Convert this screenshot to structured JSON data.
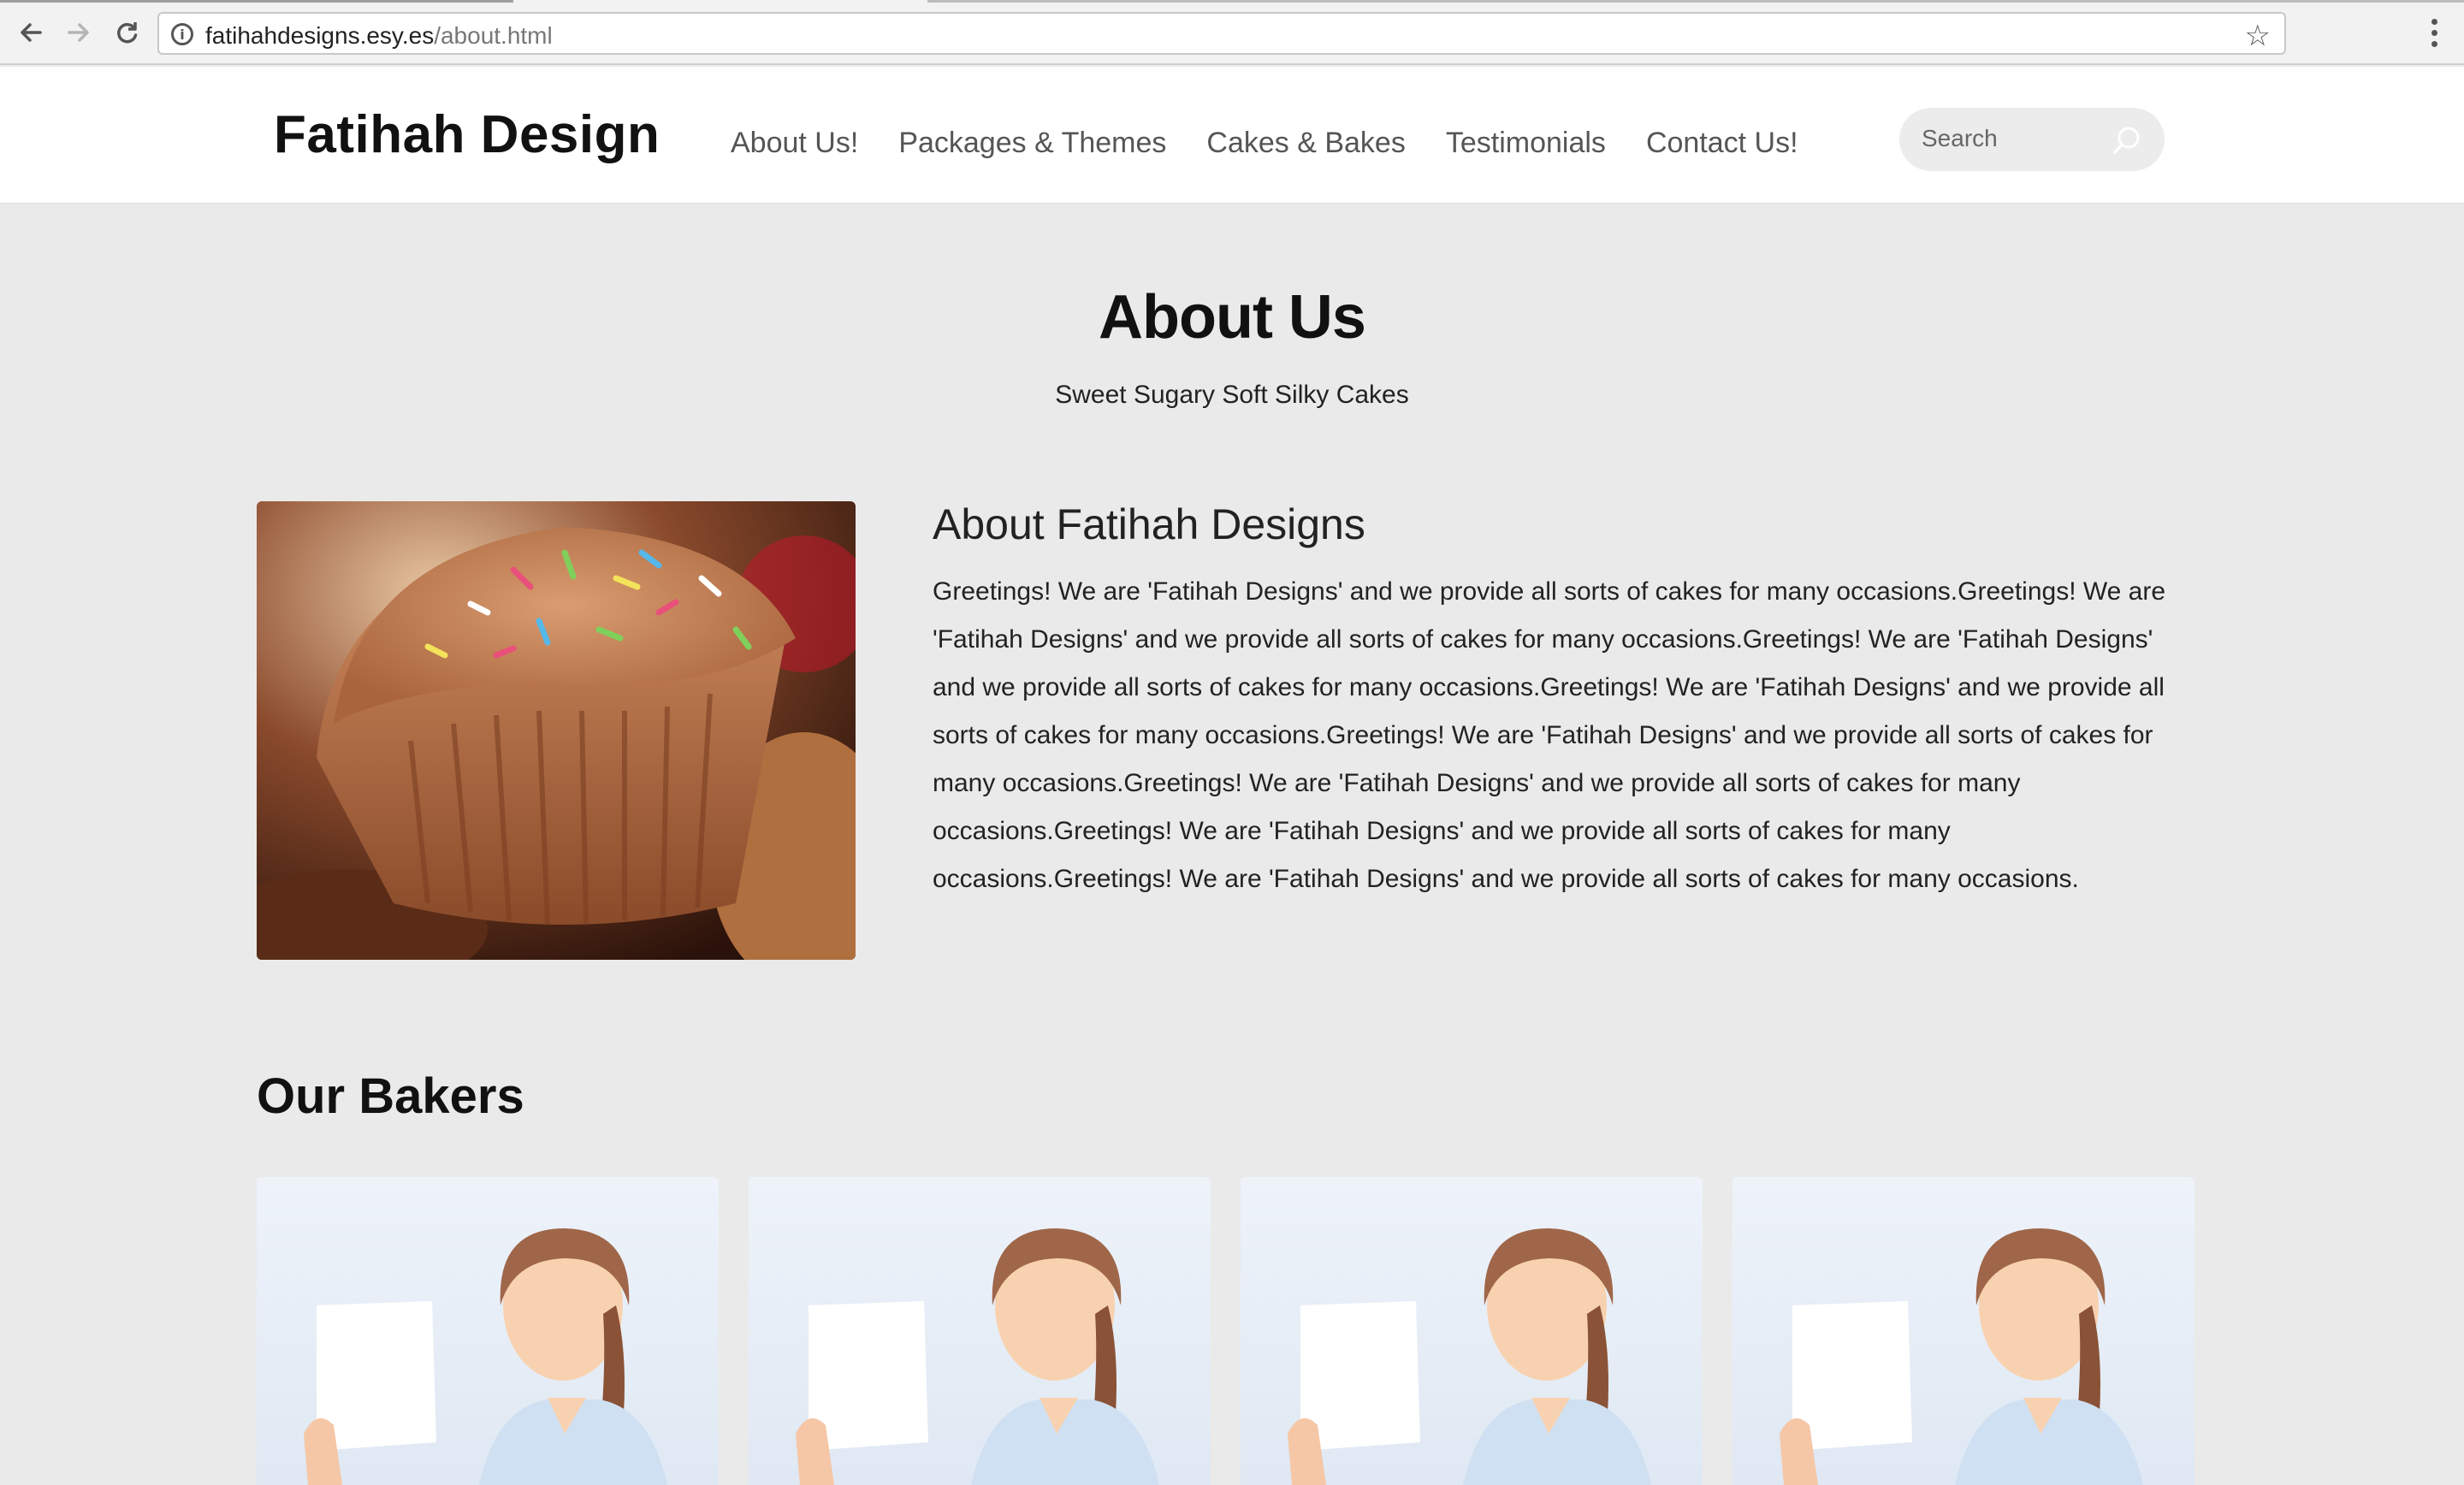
{
  "browser": {
    "url_host": "fatihahdesigns.esy.es",
    "url_path": "/about.html"
  },
  "header": {
    "logo": "Fatihah Design",
    "nav": [
      "About Us!",
      "Packages & Themes",
      "Cakes & Bakes",
      "Testimonials",
      "Contact Us!"
    ],
    "search_placeholder": "Search"
  },
  "hero": {
    "title": "About Us",
    "subtitle": "Sweet Sugary Soft Silky Cakes"
  },
  "about": {
    "heading": "About Fatihah Designs",
    "body": "Greetings! We are 'Fatihah Designs' and we provide all sorts of cakes for many occasions.Greetings! We are 'Fatihah Designs' and we provide all sorts of cakes for many occasions.Greetings! We are 'Fatihah Designs' and we provide all sorts of cakes for many occasions.Greetings! We are 'Fatihah Designs' and we provide all sorts of cakes for many occasions.Greetings! We are 'Fatihah Designs' and we provide all sorts of cakes for many occasions.Greetings! We are 'Fatihah Designs' and we provide all sorts of cakes for many occasions.Greetings! We are 'Fatihah Designs' and we provide all sorts of cakes for many occasions.Greetings! We are 'Fatihah Designs' and we provide all sorts of cakes for many occasions."
  },
  "bakers": {
    "heading": "Our Bakers",
    "count": 4
  },
  "colors": {
    "page_bg": "#eaeaea",
    "header_bg": "#ffffff",
    "nav_text": "#555555"
  }
}
